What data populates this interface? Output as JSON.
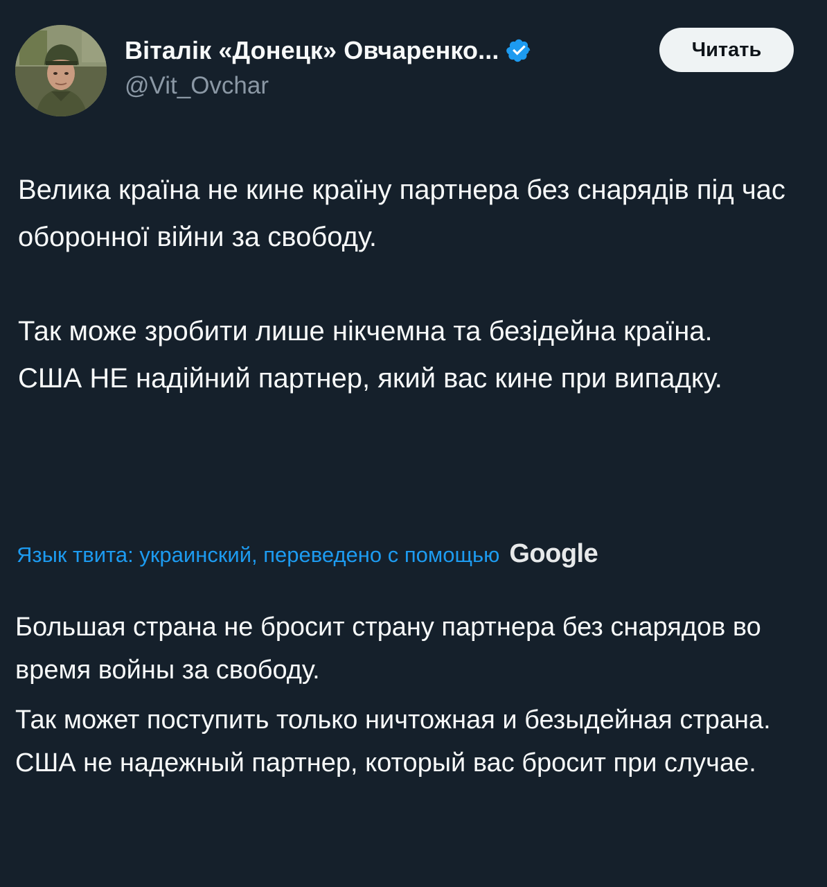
{
  "author": {
    "display_name": "Віталік «Донецк» Овчаренко...",
    "handle": "@Vit_Ovchar",
    "avatar_icon": "avatar-soldier-photo",
    "verified_icon": "verified-badge-icon",
    "verified_color": "#1d9bf0"
  },
  "follow_button": {
    "label": "Читать"
  },
  "tweet": {
    "paragraph_1": "Велика країна не кине країну партнера без снарядів під час оборонної війни за свободу.",
    "paragraph_2_line_1": "Так може зробити лише нікчемна та безідейна країна.",
    "paragraph_2_line_2": "США НЕ надійний партнер, який вас кине при випадку."
  },
  "translation": {
    "label": "Язык твита: украинский, переведено с помощью",
    "provider": "Google",
    "paragraph_1": "Большая страна не бросит страну партнера без снарядов во время войны за свободу.",
    "paragraph_2_line_1": "Так может поступить только ничтожная и безыдейная страна.",
    "paragraph_2_line_2": "США не надежный партнер, который вас бросит при случае."
  },
  "colors": {
    "background": "#15202b",
    "text": "#f7f9f9",
    "secondary_text": "#8b98a5",
    "link": "#1d9bf0",
    "button_bg": "#eff3f4"
  }
}
